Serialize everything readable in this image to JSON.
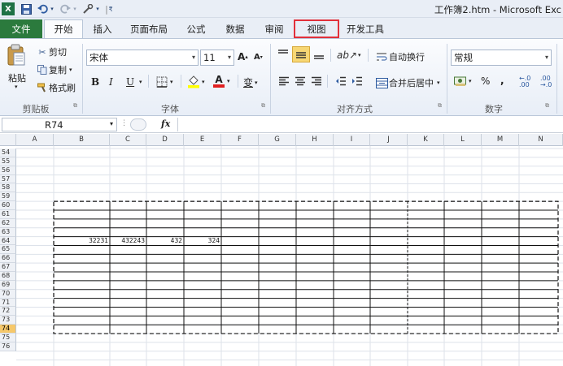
{
  "window": {
    "title": "工作簿2.htm  -  Microsoft Exc"
  },
  "quick_access": {
    "undo_icon": "undo-icon",
    "redo_icon": "redo-icon",
    "save_icon": "save-icon"
  },
  "tabs": [
    {
      "label": "文件"
    },
    {
      "label": "开始"
    },
    {
      "label": "插入"
    },
    {
      "label": "页面布局"
    },
    {
      "label": "公式"
    },
    {
      "label": "数据"
    },
    {
      "label": "审阅"
    },
    {
      "label": "视图"
    },
    {
      "label": "开发工具"
    }
  ],
  "ribbon": {
    "clipboard": {
      "paste": "粘贴",
      "cut": "剪切",
      "copy": "复制",
      "format_painter": "格式刷",
      "label": "剪贴板"
    },
    "font": {
      "font_name": "宋体",
      "font_size": "11",
      "bold": "B",
      "italic": "I",
      "underline": "U",
      "phonetic": "变",
      "label": "字体"
    },
    "alignment": {
      "wrap_text": "自动换行",
      "merge_center": "合并后居中",
      "label": "对齐方式"
    },
    "number": {
      "format": "常规",
      "percent": "%",
      "comma": ",",
      "label": "数字"
    }
  },
  "formula_bar": {
    "name_box": "R74",
    "fx": "fx"
  },
  "sheet": {
    "columns": [
      "A",
      "B",
      "C",
      "D",
      "E",
      "F",
      "G",
      "H",
      "I",
      "J",
      "K",
      "L",
      "M",
      "N"
    ],
    "rows": [
      "54",
      "55",
      "56",
      "57",
      "58",
      "59",
      "60",
      "61",
      "62",
      "63",
      "64",
      "65",
      "66",
      "67",
      "68",
      "69",
      "70",
      "71",
      "72",
      "73",
      "74",
      "75",
      "76"
    ],
    "active_row": "74",
    "values": [
      {
        "cell": "B64",
        "value": "32231"
      },
      {
        "cell": "C64",
        "value": "432243"
      },
      {
        "cell": "D64",
        "value": "432"
      },
      {
        "cell": "E64",
        "value": "324"
      }
    ]
  },
  "colors": {
    "file_tab": "#2b7a3d",
    "highlight_box": "#e2303a",
    "active_row_header": "#f6c86a"
  }
}
